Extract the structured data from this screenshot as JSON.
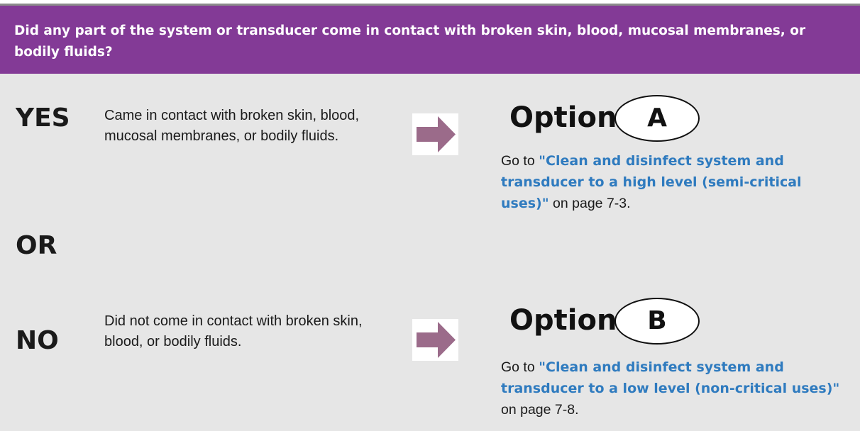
{
  "header": {
    "question": "Did any part of the system or transducer come in contact with broken skin, blood, mucosal membranes, or bodily fluids?"
  },
  "yes": {
    "answer": "YES",
    "description": "Came in contact with broken skin, blood, mucosal membranes, or bodily fluids.",
    "option_word": "Option",
    "option_letter": "A",
    "goto_prefix": "Go to ",
    "goto_link": "\"Clean and disinfect system and transducer to a high level (semi-critical uses)\"",
    "goto_suffix": " on page 7-3."
  },
  "or": {
    "label": "OR"
  },
  "no": {
    "answer": "NO",
    "description": "Did not come in contact with broken skin, blood, or bodily fluids.",
    "option_word": "Option",
    "option_letter": "B",
    "goto_prefix": "Go to ",
    "goto_link": "\"Clean and disinfect system and transducer to a low level (non-critical uses)\"",
    "goto_suffix": " on page 7-8."
  },
  "colors": {
    "header_bg": "#833a96",
    "panel_bg": "#e6e6e6",
    "arrow": "#9b6b8a",
    "link": "#2f7bbf"
  },
  "icons": {
    "arrow": "right-arrow-icon"
  }
}
